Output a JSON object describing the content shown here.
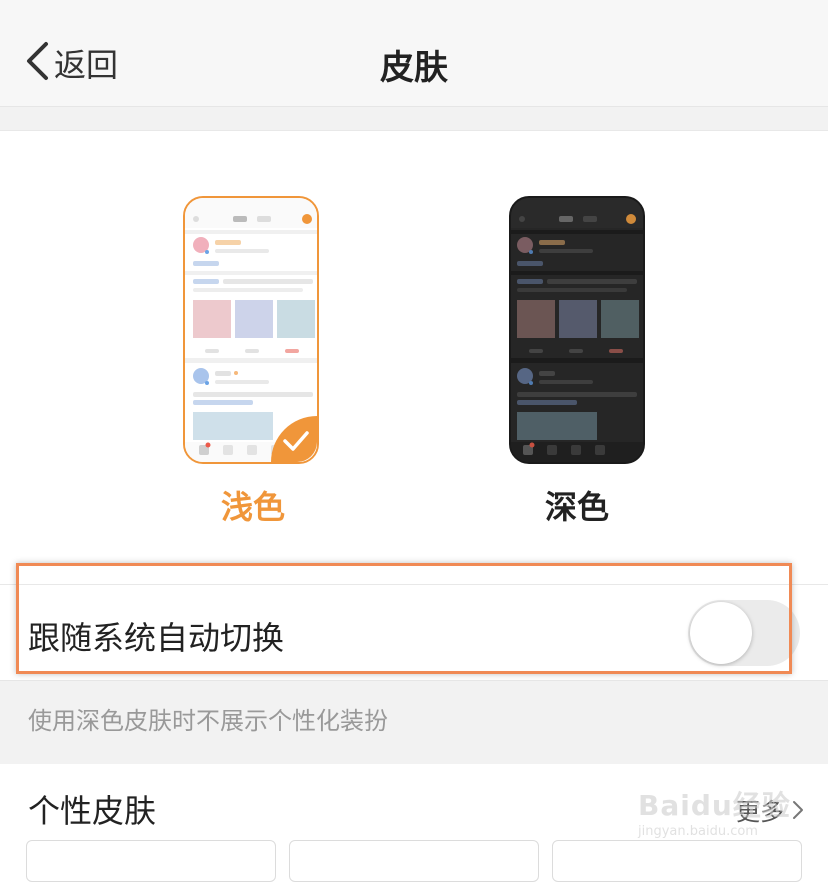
{
  "navbar": {
    "back_label": "返回",
    "title": "皮肤"
  },
  "skins": [
    {
      "label": "浅色",
      "selected": true
    },
    {
      "label": "深色",
      "selected": false
    }
  ],
  "follow_system": {
    "label": "跟随系统自动切换",
    "enabled": false
  },
  "hint": "使用深色皮肤时不展示个性化装扮",
  "section": {
    "title": "个性皮肤",
    "more_label": "更多"
  },
  "watermark": {
    "main": "Baidu经验",
    "sub": "jingyan.baidu.com"
  },
  "colors": {
    "accent": "#f0963a",
    "highlight": "#f08a55",
    "toggle_off": "#ebebeb"
  },
  "icons": {
    "back": "chevron-left-icon",
    "check": "check-icon",
    "more": "chevron-right-icon"
  }
}
